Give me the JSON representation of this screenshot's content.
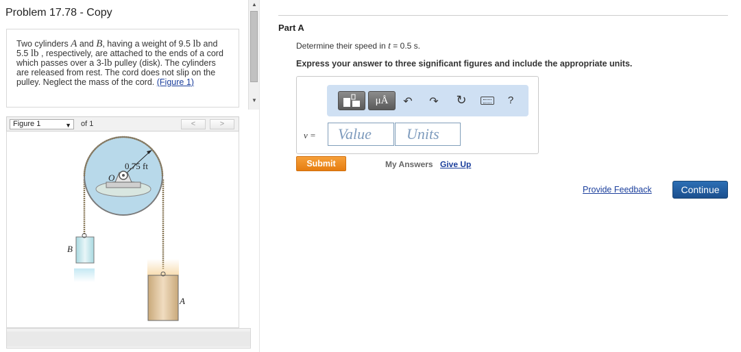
{
  "problem": {
    "title": "Problem 17.78 - Copy",
    "text_1": "Two cylinders ",
    "var_a": "A",
    "text_2": " and ",
    "var_b": "B",
    "text_3": ", having a weight of 9.5 ",
    "unit_lb": "lb",
    "text_4": "and 5.5 ",
    "text_5": " , respectively, are attached to the ends of a cord which passes over a 3-",
    "text_6": " pulley (disk). The cylinders are released from rest. The cord does not slip on the pulley. Neglect the mass of the cord.",
    "figure_link": "(Figure 1)"
  },
  "figure_nav": {
    "selected": "Figure 1",
    "of_label": "of 1",
    "prev": "<",
    "next": ">"
  },
  "figure": {
    "radius_label": "0.75 ft",
    "center_label": "O",
    "label_a": "A",
    "label_b": "B"
  },
  "part": {
    "title": "Part A",
    "question_prefix": "Determine their speed in ",
    "question_var": "t",
    "question_suffix": " = 0.5 s.",
    "instructions": "Express your answer to three significant figures and include the appropriate units."
  },
  "answer": {
    "var_label": "v =",
    "value_placeholder": "Value",
    "units_placeholder": "Units",
    "toolbar": {
      "units_label": "μÅ",
      "undo": "↶",
      "redo": "↷",
      "reset": "↻",
      "help": "?"
    }
  },
  "actions": {
    "submit": "Submit",
    "my_answers": "My Answers",
    "give_up": "Give Up",
    "feedback": "Provide Feedback",
    "continue": "Continue"
  },
  "icons": [
    "template-icon",
    "units-icon",
    "undo-icon",
    "redo-icon",
    "reset-icon",
    "keyboard-icon",
    "help-icon"
  ],
  "colors": {
    "link": "#1a3e9c",
    "submit": "#f0901f",
    "continue": "#1f5a9c",
    "toolbar_bg": "#cfe0f3",
    "pulley": "#b8d9ea"
  }
}
